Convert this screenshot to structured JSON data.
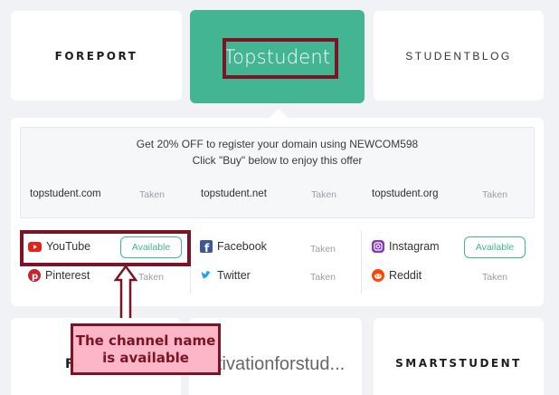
{
  "top_cards": {
    "foreport": "FOREPORT",
    "topstudent": "Topstudent",
    "studentblog": "STUDENTBLOG"
  },
  "offer": {
    "line1": "Get 20% OFF to register your domain using NEWCOM598",
    "line2": "Click \"Buy\" below to enjoy this offer"
  },
  "domains": [
    {
      "name": "topstudent.com",
      "status": "Taken"
    },
    {
      "name": "topstudent.net",
      "status": "Taken"
    },
    {
      "name": "topstudent.org",
      "status": "Taken"
    }
  ],
  "socials": {
    "youtube": {
      "name": "YouTube",
      "status": "Available"
    },
    "pinterest": {
      "name": "Pinterest",
      "status": "Taken"
    },
    "facebook": {
      "name": "Facebook",
      "status": "Taken"
    },
    "twitter": {
      "name": "Twitter",
      "status": "Taken"
    },
    "instagram": {
      "name": "Instagram",
      "status": "Available"
    },
    "reddit": {
      "name": "Reddit",
      "status": "Taken"
    }
  },
  "bottom_cards": {
    "left_partial": "F",
    "middle_partial": "tivationforstud...",
    "smartstudent": "SMARTSTUDENT"
  },
  "annotation": {
    "line1": "The channel name",
    "line2": "is available"
  },
  "colors": {
    "accent_green": "#43b592",
    "annotation_border": "#7a1426",
    "annotation_fill": "#fbb6c7",
    "youtube": "#e62117",
    "facebook": "#3b5998",
    "twitter": "#1da1f2",
    "pinterest": "#c8232c",
    "instagram": "#8a3ab9",
    "reddit": "#ff4500"
  },
  "icons": [
    "youtube-icon",
    "pinterest-icon",
    "facebook-icon",
    "twitter-icon",
    "instagram-icon",
    "reddit-icon",
    "arrow-up-icon"
  ]
}
